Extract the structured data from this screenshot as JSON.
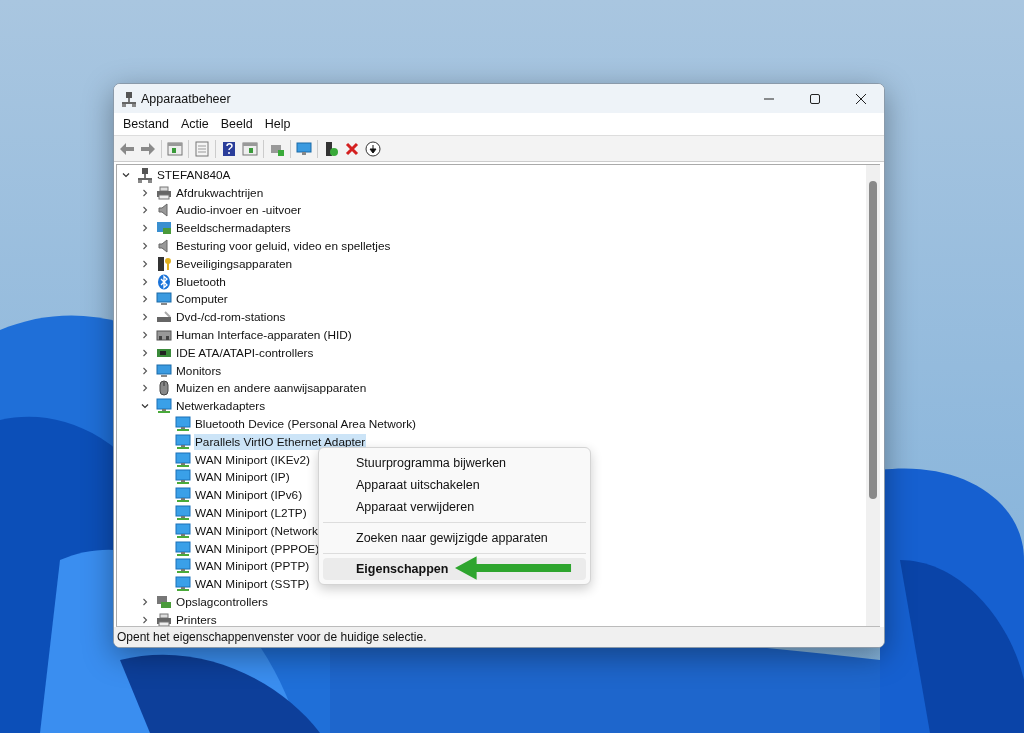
{
  "window": {
    "title": "Apparaatbeheer"
  },
  "menu_bar": [
    "Bestand",
    "Actie",
    "Beeld",
    "Help"
  ],
  "tree": {
    "label": "STEFAN840A",
    "expanded": true,
    "selected": false,
    "children": [
      {
        "label": "Afdrukwachtrijen",
        "expanded": false,
        "selected": false
      },
      {
        "label": "Audio-invoer en -uitvoer",
        "expanded": false,
        "selected": false
      },
      {
        "label": "Beeldschermadapters",
        "expanded": false,
        "selected": false
      },
      {
        "label": "Besturing voor geluid, video en spelletjes",
        "expanded": false,
        "selected": false
      },
      {
        "label": "Beveiligingsapparaten",
        "expanded": false,
        "selected": false
      },
      {
        "label": "Bluetooth",
        "expanded": false,
        "selected": false
      },
      {
        "label": "Computer",
        "expanded": false,
        "selected": false
      },
      {
        "label": "Dvd-/cd-rom-stations",
        "expanded": false,
        "selected": false
      },
      {
        "label": "Human Interface-apparaten (HID)",
        "expanded": false,
        "selected": false
      },
      {
        "label": "IDE ATA/ATAPI-controllers",
        "expanded": false,
        "selected": false
      },
      {
        "label": "Monitors",
        "expanded": false,
        "selected": false
      },
      {
        "label": "Muizen en andere aanwijsapparaten",
        "expanded": false,
        "selected": false
      },
      {
        "label": "Netwerkadapters",
        "expanded": true,
        "selected": false,
        "children": [
          {
            "label": "Bluetooth Device (Personal Area Network)",
            "selected": false
          },
          {
            "label": "Parallels VirtIO Ethernet Adapter",
            "selected": true
          },
          {
            "label": "WAN Miniport (IKEv2)",
            "selected": false
          },
          {
            "label": "WAN Miniport (IP)",
            "selected": false
          },
          {
            "label": "WAN Miniport (IPv6)",
            "selected": false
          },
          {
            "label": "WAN Miniport (L2TP)",
            "selected": false
          },
          {
            "label": "WAN Miniport (Network",
            "selected": false
          },
          {
            "label": "WAN Miniport (PPPOE)",
            "selected": false
          },
          {
            "label": "WAN Miniport (PPTP)",
            "selected": false
          },
          {
            "label": "WAN Miniport (SSTP)",
            "selected": false
          }
        ]
      },
      {
        "label": "Opslagcontrollers",
        "expanded": false,
        "selected": false
      },
      {
        "label": "Printers",
        "expanded": false,
        "selected": false
      }
    ]
  },
  "context_menu": {
    "groups": [
      [
        {
          "label": "Stuurprogramma bijwerken",
          "selected": false,
          "default": false
        },
        {
          "label": "Apparaat uitschakelen",
          "selected": false,
          "default": false
        },
        {
          "label": "Apparaat verwijderen",
          "selected": false,
          "default": false
        }
      ],
      [
        {
          "label": "Zoeken naar gewijzigde apparaten",
          "selected": false,
          "default": false
        }
      ],
      [
        {
          "label": "Eigenschappen",
          "selected": true,
          "default": true
        }
      ]
    ]
  },
  "status_bar": {
    "text": "Opent het eigenschappenvenster voor de huidige selectie."
  }
}
